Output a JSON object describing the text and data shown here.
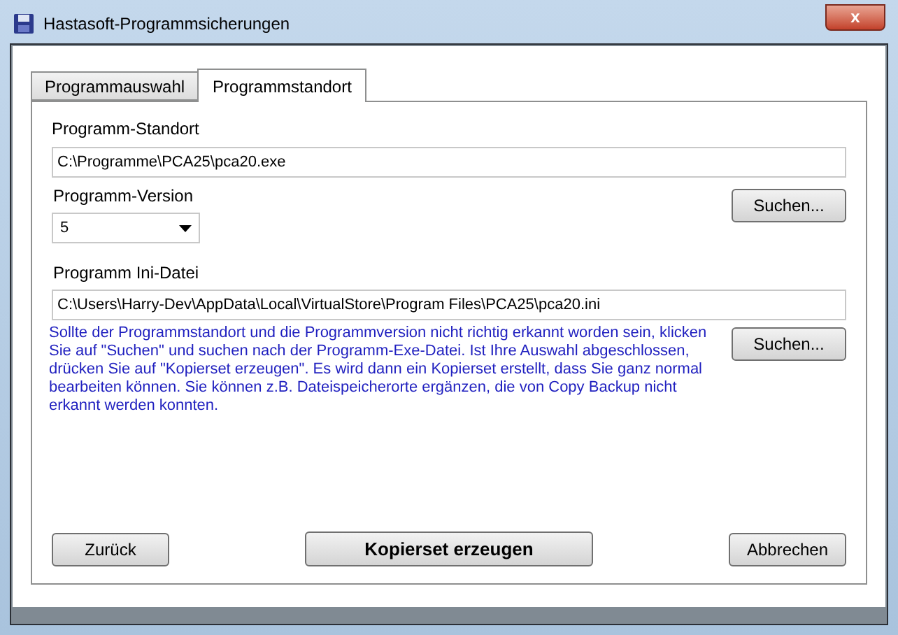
{
  "window": {
    "title": "Hastasoft-Programmsicherungen",
    "close": "x"
  },
  "tabs": [
    {
      "label": "Programmauswahl",
      "selected": false
    },
    {
      "label": "Programmstandort",
      "selected": true
    }
  ],
  "location": {
    "label": "Programm-Standort",
    "value": "C:\\Programme\\PCA25\\pca20.exe",
    "button": "Suchen..."
  },
  "version": {
    "label": "Programm-Version",
    "value": "5"
  },
  "ini": {
    "label": "Programm Ini-Datei",
    "value": "C:\\Users\\Harry-Dev\\AppData\\Local\\VirtualStore\\Program Files\\PCA25\\pca20.ini",
    "button": "Suchen..."
  },
  "hint": "Sollte der Programmstandort und die Programmversion nicht richtig erkannt worden sein, klicken Sie auf \"Suchen\" und suchen nach der Programm-Exe-Datei.  Ist Ihre Auswahl abgeschlossen, drücken Sie auf \"Kopierset erzeugen\". Es wird dann ein Kopierset erstellt, dass Sie ganz normal bearbeiten können. Sie können z.B. Dateispeicherorte ergänzen, die von Copy Backup nicht erkannt werden konnten.",
  "buttons": [
    {
      "label": "Zurück",
      "kind": "normal"
    },
    {
      "label": "Kopierset erzeugen",
      "kind": "primary"
    },
    {
      "label": "Abbrechen",
      "kind": "normal"
    }
  ]
}
